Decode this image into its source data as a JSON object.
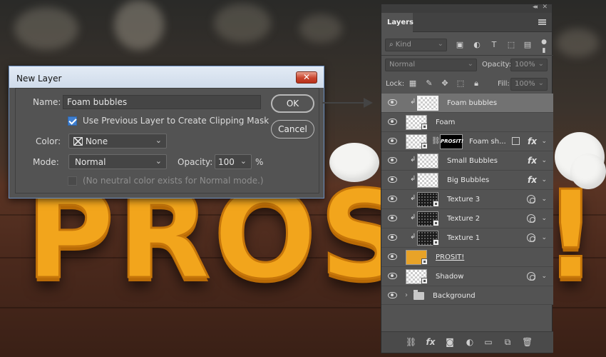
{
  "scene": {
    "artwork_text": "PROSIT!"
  },
  "dialog": {
    "title": "New Layer",
    "close_glyph": "✕",
    "name_label": "Name:",
    "name_value": "Foam bubbles",
    "clipping_label": "Use Previous Layer to Create Clipping Mask",
    "clipping_checked": true,
    "color_label": "Color:",
    "color_value": "None",
    "mode_label": "Mode:",
    "mode_value": "Normal",
    "opacity_label": "Opacity:",
    "opacity_value": "100",
    "opacity_unit": "%",
    "neutral_label": "(No neutral color exists for Normal mode.)",
    "ok_label": "OK",
    "cancel_label": "Cancel"
  },
  "panel": {
    "tab_label": "Layers",
    "filter_placeholder": "Kind",
    "blend_mode": "Normal",
    "opacity_label": "Opacity:",
    "opacity_value": "100%",
    "lock_label": "Lock:",
    "fill_label": "Fill:",
    "fill_value": "100%",
    "layers": [
      {
        "name": "Foam bubbles",
        "selected": true,
        "clipped": true
      },
      {
        "name": "Foam",
        "clipped": false
      },
      {
        "name": "Foam sh...",
        "mask_text": "PROSIT!",
        "clipped": false,
        "fx": true
      },
      {
        "name": "Small Bubbles",
        "clipped": true,
        "fx": true
      },
      {
        "name": "Big Bubbles",
        "clipped": true,
        "fx": true
      },
      {
        "name": "Texture 3",
        "clipped": true,
        "style": true
      },
      {
        "name": "Texture 2",
        "clipped": true,
        "style": true
      },
      {
        "name": "Texture 1",
        "clipped": true,
        "style": true
      },
      {
        "name": "PROSIT!",
        "clipped": false
      },
      {
        "name": "Shadow",
        "clipped": false,
        "style": true
      },
      {
        "name": "Background",
        "group": true
      }
    ],
    "fx_glyph": "fx"
  }
}
